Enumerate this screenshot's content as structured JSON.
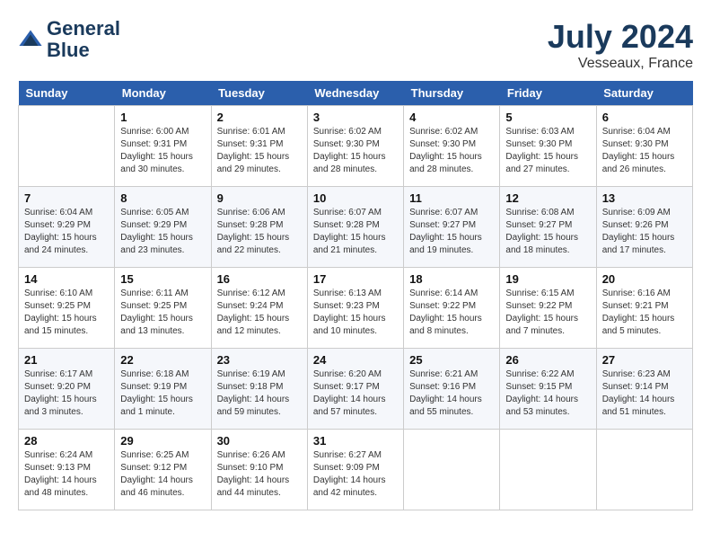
{
  "header": {
    "logo_line1": "General",
    "logo_line2": "Blue",
    "month": "July 2024",
    "location": "Vesseaux, France"
  },
  "days_of_week": [
    "Sunday",
    "Monday",
    "Tuesday",
    "Wednesday",
    "Thursday",
    "Friday",
    "Saturday"
  ],
  "weeks": [
    [
      {
        "day": "",
        "content": ""
      },
      {
        "day": "1",
        "content": "Sunrise: 6:00 AM\nSunset: 9:31 PM\nDaylight: 15 hours\nand 30 minutes."
      },
      {
        "day": "2",
        "content": "Sunrise: 6:01 AM\nSunset: 9:31 PM\nDaylight: 15 hours\nand 29 minutes."
      },
      {
        "day": "3",
        "content": "Sunrise: 6:02 AM\nSunset: 9:30 PM\nDaylight: 15 hours\nand 28 minutes."
      },
      {
        "day": "4",
        "content": "Sunrise: 6:02 AM\nSunset: 9:30 PM\nDaylight: 15 hours\nand 28 minutes."
      },
      {
        "day": "5",
        "content": "Sunrise: 6:03 AM\nSunset: 9:30 PM\nDaylight: 15 hours\nand 27 minutes."
      },
      {
        "day": "6",
        "content": "Sunrise: 6:04 AM\nSunset: 9:30 PM\nDaylight: 15 hours\nand 26 minutes."
      }
    ],
    [
      {
        "day": "7",
        "content": "Sunrise: 6:04 AM\nSunset: 9:29 PM\nDaylight: 15 hours\nand 24 minutes."
      },
      {
        "day": "8",
        "content": "Sunrise: 6:05 AM\nSunset: 9:29 PM\nDaylight: 15 hours\nand 23 minutes."
      },
      {
        "day": "9",
        "content": "Sunrise: 6:06 AM\nSunset: 9:28 PM\nDaylight: 15 hours\nand 22 minutes."
      },
      {
        "day": "10",
        "content": "Sunrise: 6:07 AM\nSunset: 9:28 PM\nDaylight: 15 hours\nand 21 minutes."
      },
      {
        "day": "11",
        "content": "Sunrise: 6:07 AM\nSunset: 9:27 PM\nDaylight: 15 hours\nand 19 minutes."
      },
      {
        "day": "12",
        "content": "Sunrise: 6:08 AM\nSunset: 9:27 PM\nDaylight: 15 hours\nand 18 minutes."
      },
      {
        "day": "13",
        "content": "Sunrise: 6:09 AM\nSunset: 9:26 PM\nDaylight: 15 hours\nand 17 minutes."
      }
    ],
    [
      {
        "day": "14",
        "content": "Sunrise: 6:10 AM\nSunset: 9:25 PM\nDaylight: 15 hours\nand 15 minutes."
      },
      {
        "day": "15",
        "content": "Sunrise: 6:11 AM\nSunset: 9:25 PM\nDaylight: 15 hours\nand 13 minutes."
      },
      {
        "day": "16",
        "content": "Sunrise: 6:12 AM\nSunset: 9:24 PM\nDaylight: 15 hours\nand 12 minutes."
      },
      {
        "day": "17",
        "content": "Sunrise: 6:13 AM\nSunset: 9:23 PM\nDaylight: 15 hours\nand 10 minutes."
      },
      {
        "day": "18",
        "content": "Sunrise: 6:14 AM\nSunset: 9:22 PM\nDaylight: 15 hours\nand 8 minutes."
      },
      {
        "day": "19",
        "content": "Sunrise: 6:15 AM\nSunset: 9:22 PM\nDaylight: 15 hours\nand 7 minutes."
      },
      {
        "day": "20",
        "content": "Sunrise: 6:16 AM\nSunset: 9:21 PM\nDaylight: 15 hours\nand 5 minutes."
      }
    ],
    [
      {
        "day": "21",
        "content": "Sunrise: 6:17 AM\nSunset: 9:20 PM\nDaylight: 15 hours\nand 3 minutes."
      },
      {
        "day": "22",
        "content": "Sunrise: 6:18 AM\nSunset: 9:19 PM\nDaylight: 15 hours\nand 1 minute."
      },
      {
        "day": "23",
        "content": "Sunrise: 6:19 AM\nSunset: 9:18 PM\nDaylight: 14 hours\nand 59 minutes."
      },
      {
        "day": "24",
        "content": "Sunrise: 6:20 AM\nSunset: 9:17 PM\nDaylight: 14 hours\nand 57 minutes."
      },
      {
        "day": "25",
        "content": "Sunrise: 6:21 AM\nSunset: 9:16 PM\nDaylight: 14 hours\nand 55 minutes."
      },
      {
        "day": "26",
        "content": "Sunrise: 6:22 AM\nSunset: 9:15 PM\nDaylight: 14 hours\nand 53 minutes."
      },
      {
        "day": "27",
        "content": "Sunrise: 6:23 AM\nSunset: 9:14 PM\nDaylight: 14 hours\nand 51 minutes."
      }
    ],
    [
      {
        "day": "28",
        "content": "Sunrise: 6:24 AM\nSunset: 9:13 PM\nDaylight: 14 hours\nand 48 minutes."
      },
      {
        "day": "29",
        "content": "Sunrise: 6:25 AM\nSunset: 9:12 PM\nDaylight: 14 hours\nand 46 minutes."
      },
      {
        "day": "30",
        "content": "Sunrise: 6:26 AM\nSunset: 9:10 PM\nDaylight: 14 hours\nand 44 minutes."
      },
      {
        "day": "31",
        "content": "Sunrise: 6:27 AM\nSunset: 9:09 PM\nDaylight: 14 hours\nand 42 minutes."
      },
      {
        "day": "",
        "content": ""
      },
      {
        "day": "",
        "content": ""
      },
      {
        "day": "",
        "content": ""
      }
    ]
  ]
}
